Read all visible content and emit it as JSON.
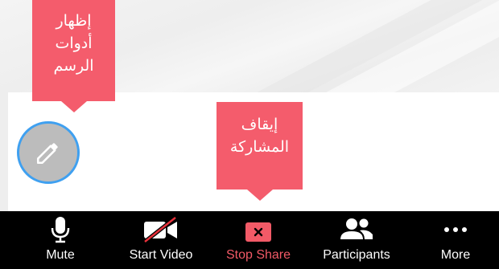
{
  "callouts": {
    "show_drawing_tools": [
      "إظهار",
      "أدوات",
      "الرسم"
    ],
    "stop_sharing": [
      "إيقاف",
      "المشاركة"
    ]
  },
  "floating_button": {
    "icon": "pencil-icon"
  },
  "toolbar": {
    "mute": {
      "label": "Mute",
      "icon": "microphone-icon"
    },
    "start_video": {
      "label": "Start Video",
      "icon": "video-off-icon"
    },
    "stop_share": {
      "label": "Stop Share",
      "icon": "stop-share-icon"
    },
    "participants": {
      "label": "Participants",
      "icon": "participants-icon"
    },
    "more": {
      "label": "More",
      "icon": "more-dots-icon"
    }
  },
  "colors": {
    "callout_bg": "#f45c6c",
    "toolbar_bg": "#000000",
    "stop_share_red": "#f25a67",
    "pencil_button_bg": "#bcbcbc",
    "pencil_button_border": "#3fa0f0"
  }
}
